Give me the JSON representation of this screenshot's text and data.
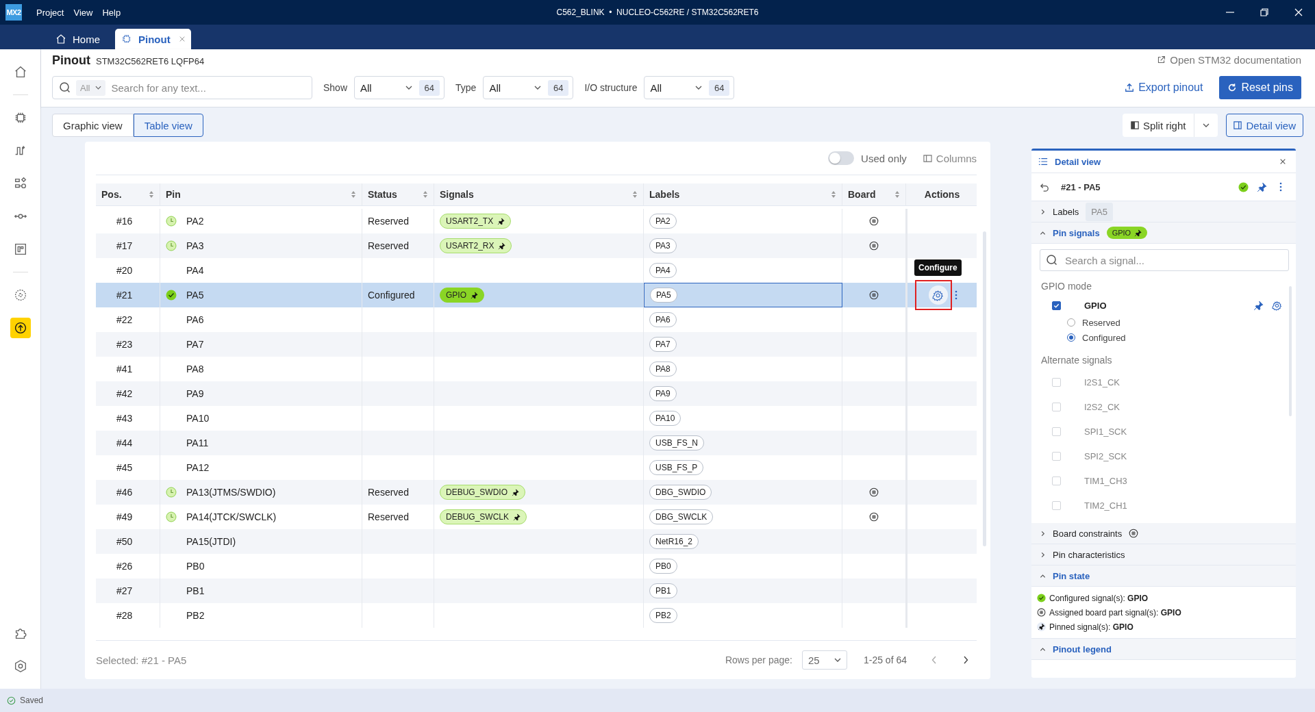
{
  "window": {
    "logo": "MX2",
    "menu": [
      "Project",
      "View",
      "Help"
    ],
    "title": "C562_BLINK  •  NUCLEO-C562RE / STM32C562RET6"
  },
  "tabs": [
    {
      "label": "Home",
      "kind": "home",
      "selected": false
    },
    {
      "label": "Pinout",
      "kind": "chip",
      "selected": true
    }
  ],
  "sidebar": {
    "groups": [
      [
        {
          "kind": "home",
          "selected": false
        }
      ],
      [
        {
          "kind": "chip",
          "selected": false
        },
        {
          "kind": "wave",
          "selected": false
        },
        {
          "kind": "nodes",
          "selected": false
        },
        {
          "kind": "connector",
          "selected": false
        },
        {
          "kind": "board",
          "selected": false
        }
      ],
      [
        {
          "kind": "gear",
          "selected": false
        },
        {
          "kind": "upload",
          "selected": true
        }
      ]
    ],
    "bottom": [
      {
        "kind": "puzzle",
        "selected": false
      },
      {
        "kind": "settings",
        "selected": false
      }
    ]
  },
  "header": {
    "title": "Pinout",
    "subtitle": "STM32C562RET6 LQFP64",
    "doc_link": "Open STM32 documentation"
  },
  "search": {
    "scope": "All",
    "placeholder": "Search for any text..."
  },
  "filters": [
    {
      "label": "Show",
      "value": "All",
      "count": "64"
    },
    {
      "label": "Type",
      "value": "All",
      "count": "64"
    },
    {
      "label": "I/O structure",
      "value": "All",
      "count": "64"
    }
  ],
  "export_button": "Export pinout",
  "reset_button": "Reset pins",
  "views": [
    {
      "label": "Graphic view",
      "selected": false
    },
    {
      "label": "Table view",
      "selected": true
    }
  ],
  "split_button": "Split right",
  "detail_button": "Detail view",
  "table": {
    "used_only": {
      "label": "Used only",
      "on": false
    },
    "columns_button": "Columns",
    "tooltip": "Configure",
    "columns": [
      {
        "label": "Pos.",
        "sortable": true
      },
      {
        "label": "Pin",
        "sortable": true
      },
      {
        "label": "Status",
        "sortable": true
      },
      {
        "label": "Signals",
        "sortable": true
      },
      {
        "label": "Labels",
        "sortable": true
      },
      {
        "label": "Board",
        "sortable": true
      },
      {
        "label": "Actions",
        "sortable": false
      }
    ],
    "rows": [
      {
        "pos": "#16",
        "pin": "PA2",
        "kind": "reserved",
        "status": "Reserved",
        "signal": "USART2_TX",
        "label": "PA2",
        "board": true,
        "selected": false
      },
      {
        "pos": "#17",
        "pin": "PA3",
        "kind": "reserved",
        "status": "Reserved",
        "signal": "USART2_RX",
        "label": "PA3",
        "board": true,
        "selected": false
      },
      {
        "pos": "#20",
        "pin": "PA4",
        "kind": "free",
        "label": "PA4",
        "board": false,
        "selected": false
      },
      {
        "pos": "#21",
        "pin": "PA5",
        "kind": "configured",
        "status": "Configured",
        "signal": "GPIO",
        "label": "PA5",
        "board": true,
        "selected": true
      },
      {
        "pos": "#22",
        "pin": "PA6",
        "kind": "free",
        "label": "PA6",
        "board": false,
        "selected": false
      },
      {
        "pos": "#23",
        "pin": "PA7",
        "kind": "free",
        "label": "PA7",
        "board": false,
        "selected": false
      },
      {
        "pos": "#41",
        "pin": "PA8",
        "kind": "free",
        "label": "PA8",
        "board": false,
        "selected": false
      },
      {
        "pos": "#42",
        "pin": "PA9",
        "kind": "free",
        "label": "PA9",
        "board": false,
        "selected": false
      },
      {
        "pos": "#43",
        "pin": "PA10",
        "kind": "free",
        "label": "PA10",
        "board": false,
        "selected": false
      },
      {
        "pos": "#44",
        "pin": "PA11",
        "kind": "free",
        "label": "USB_FS_N",
        "board": false,
        "selected": false
      },
      {
        "pos": "#45",
        "pin": "PA12",
        "kind": "free",
        "label": "USB_FS_P",
        "board": false,
        "selected": false
      },
      {
        "pos": "#46",
        "pin": "PA13(JTMS/SWDIO)",
        "kind": "reserved",
        "status": "Reserved",
        "signal": "DEBUG_SWDIO",
        "label": "DBG_SWDIO",
        "board": true,
        "selected": false
      },
      {
        "pos": "#49",
        "pin": "PA14(JTCK/SWCLK)",
        "kind": "reserved",
        "status": "Reserved",
        "signal": "DEBUG_SWCLK",
        "label": "DBG_SWCLK",
        "board": true,
        "selected": false
      },
      {
        "pos": "#50",
        "pin": "PA15(JTDI)",
        "kind": "free",
        "label": "NetR16_2",
        "board": false,
        "selected": false
      },
      {
        "pos": "#26",
        "pin": "PB0",
        "kind": "free",
        "label": "PB0",
        "board": false,
        "selected": false
      },
      {
        "pos": "#27",
        "pin": "PB1",
        "kind": "free",
        "label": "PB1",
        "board": false,
        "selected": false
      },
      {
        "pos": "#28",
        "pin": "PB2",
        "kind": "free",
        "label": "PB2",
        "board": false,
        "selected": false
      }
    ],
    "footer": {
      "selected": "Selected: #21 - PA5",
      "rows_label": "Rows per page:",
      "rows_value": "25",
      "range": "1-25 of 64"
    }
  },
  "detail": {
    "title": "Detail view",
    "pin": "#21 - PA5",
    "kind": "configured",
    "sections": [
      {
        "kind": "labels",
        "title": "Labels",
        "expanded": false,
        "value": "PA5"
      },
      {
        "kind": "signals",
        "title": "Pin signals",
        "expanded": true,
        "badge": "GPIO",
        "search": {
          "placeholder": "Search a signal..."
        },
        "mode_title": "GPIO mode",
        "mode": {
          "name": "GPIO",
          "checked": true,
          "options": [
            {
              "label": "Reserved",
              "selected": false
            },
            {
              "label": "Configured",
              "selected": true
            }
          ]
        },
        "alt_title": "Alternate signals",
        "alternates": [
          {
            "name": "I2S1_CK",
            "checked": false
          },
          {
            "name": "I2S2_CK",
            "checked": false
          },
          {
            "name": "SPI1_SCK",
            "checked": false
          },
          {
            "name": "SPI2_SCK",
            "checked": false
          },
          {
            "name": "TIM1_CH3",
            "checked": false
          },
          {
            "name": "TIM2_CH1",
            "checked": false
          }
        ]
      },
      {
        "kind": "board",
        "title": "Board constraints",
        "expanded": false
      },
      {
        "kind": "plain",
        "title": "Pin characteristics",
        "expanded": false
      },
      {
        "kind": "state",
        "title": "Pin state",
        "expanded": true,
        "lines": [
          {
            "kind": "configured",
            "text": "Configured signal(s): **GPIO**"
          },
          {
            "kind": "board",
            "text": "Assigned board part signal(s): **GPIO**"
          },
          {
            "kind": "pinned",
            "text": "Pinned signal(s): **GPIO**"
          }
        ]
      },
      {
        "kind": "plain",
        "title": "Pinout legend",
        "expanded": true
      }
    ]
  },
  "status_bar": {
    "text": "Saved"
  }
}
